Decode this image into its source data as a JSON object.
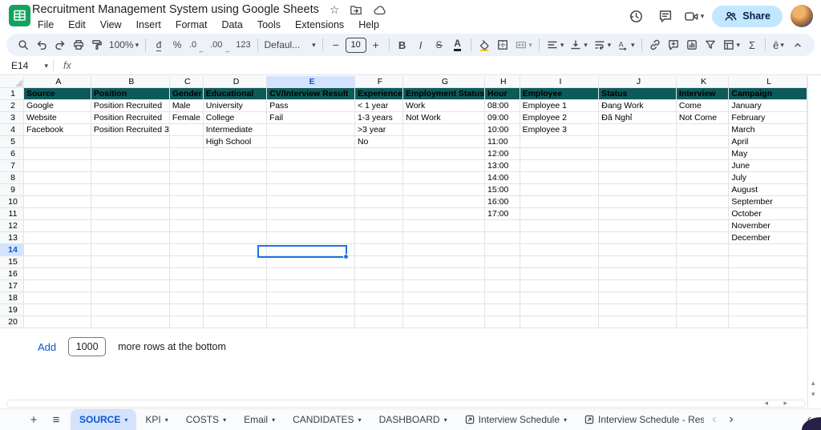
{
  "titlebar": {
    "title": "Recruitment Management System using Google Sheets",
    "menus": [
      "File",
      "Edit",
      "View",
      "Insert",
      "Format",
      "Data",
      "Tools",
      "Extensions",
      "Help"
    ],
    "share_label": "Share"
  },
  "toolbar": {
    "zoom_value": "100%",
    "currency_symbol": "đ",
    "percent_symbol": "%",
    "decrease_decimal": ".0",
    "increase_decimal": ".00",
    "more_formats": "123",
    "font_name": "Defaul...",
    "font_size": "10",
    "bold": "B",
    "italic": "I",
    "strikethrough": "S",
    "text_color": "A",
    "minus": "−",
    "plus": "+",
    "sum_symbol": "Σ",
    "input_tools": "ê"
  },
  "formula_bar": {
    "cell_reference": "E14",
    "fx_label": "fx",
    "content": ""
  },
  "grid": {
    "column_letters": [
      "A",
      "B",
      "C",
      "D",
      "E",
      "F",
      "G",
      "H",
      "I",
      "J",
      "K",
      "L"
    ],
    "selected_column": "E",
    "selected_row": 14,
    "selected_cell": "E14",
    "header_row": [
      "Source",
      "Position",
      "Gender",
      "Educational",
      "CV/Interview Result",
      "Experience",
      "Employment Status",
      "Hour",
      "Employee",
      "Status",
      "Interview",
      "Campaign"
    ],
    "data_rows": [
      [
        "Google",
        "Position Recruited",
        "Male",
        "University",
        "Pass",
        "< 1 year",
        "Work",
        "08:00",
        "Employee 1",
        "Đang Work",
        "Come",
        "January"
      ],
      [
        "Website",
        "Position Recruited",
        "Female",
        "College",
        "Fail",
        "1-3 years",
        "Not Work",
        "09:00",
        "Employee 2",
        "Đã Nghỉ",
        "Not Come",
        "February"
      ],
      [
        "Facebook",
        "Position Recruited 3",
        "",
        "Intermediate",
        "",
        ">3 year",
        "",
        "10:00",
        "Employee 3",
        "",
        "",
        "March"
      ],
      [
        "",
        "",
        "",
        "High School",
        "",
        "No",
        "",
        "11:00",
        "",
        "",
        "",
        "April"
      ],
      [
        "",
        "",
        "",
        "",
        "",
        "",
        "",
        "12:00",
        "",
        "",
        "",
        "May"
      ],
      [
        "",
        "",
        "",
        "",
        "",
        "",
        "",
        "13:00",
        "",
        "",
        "",
        "June"
      ],
      [
        "",
        "",
        "",
        "",
        "",
        "",
        "",
        "14:00",
        "",
        "",
        "",
        "July"
      ],
      [
        "",
        "",
        "",
        "",
        "",
        "",
        "",
        "15:00",
        "",
        "",
        "",
        "August"
      ],
      [
        "",
        "",
        "",
        "",
        "",
        "",
        "",
        "16:00",
        "",
        "",
        "",
        "September"
      ],
      [
        "",
        "",
        "",
        "",
        "",
        "",
        "",
        "17:00",
        "",
        "",
        "",
        "October"
      ],
      [
        "",
        "",
        "",
        "",
        "",
        "",
        "",
        "",
        "",
        "",
        "",
        "November"
      ],
      [
        "",
        "",
        "",
        "",
        "",
        "",
        "",
        "",
        "",
        "",
        "",
        "December"
      ],
      [
        "",
        "",
        "",
        "",
        "",
        "",
        "",
        "",
        "",
        "",
        "",
        ""
      ],
      [
        "",
        "",
        "",
        "",
        "",
        "",
        "",
        "",
        "",
        "",
        "",
        ""
      ],
      [
        "",
        "",
        "",
        "",
        "",
        "",
        "",
        "",
        "",
        "",
        "",
        ""
      ],
      [
        "",
        "",
        "",
        "",
        "",
        "",
        "",
        "",
        "",
        "",
        "",
        ""
      ],
      [
        "",
        "",
        "",
        "",
        "",
        "",
        "",
        "",
        "",
        "",
        "",
        ""
      ],
      [
        "",
        "",
        "",
        "",
        "",
        "",
        "",
        "",
        "",
        "",
        "",
        ""
      ],
      [
        "",
        "",
        "",
        "",
        "",
        "",
        "",
        "",
        "",
        "",
        "",
        ""
      ]
    ]
  },
  "add_rows": {
    "add_label": "Add",
    "row_count_value": "1000",
    "suffix_label": "more rows at the bottom"
  },
  "sheet_tabs": {
    "tabs": [
      {
        "label": "SOURCE",
        "active": true,
        "dropdown": true,
        "icon": false,
        "clipped": false
      },
      {
        "label": "KPI",
        "active": false,
        "dropdown": true,
        "icon": false,
        "clipped": false
      },
      {
        "label": "COSTS",
        "active": false,
        "dropdown": true,
        "icon": false,
        "clipped": false
      },
      {
        "label": "Email",
        "active": false,
        "dropdown": true,
        "icon": false,
        "clipped": false
      },
      {
        "label": "CANDIDATES",
        "active": false,
        "dropdown": true,
        "icon": false,
        "clipped": false
      },
      {
        "label": "DASHBOARD",
        "active": false,
        "dropdown": true,
        "icon": false,
        "clipped": false
      },
      {
        "label": "Interview Schedule",
        "active": false,
        "dropdown": true,
        "icon": true,
        "clipped": false
      },
      {
        "label": "Interview Schedule - Responsible",
        "active": false,
        "dropdown": false,
        "icon": true,
        "clipped": true
      }
    ]
  },
  "icons": {
    "dropdown_caret": "▾",
    "star": "☆",
    "nav_prev": "‹",
    "nav_next": "›",
    "collapse_right": "‹",
    "add_sheet": "+",
    "all_sheets": "≡",
    "scroll_up": "▴",
    "scroll_down": "▾",
    "scroll_left": "◂",
    "scroll_right": "▸",
    "dec_arrow": "←",
    "inc_arrow": "→"
  },
  "colors": {
    "accent_blue": "#0b57d0",
    "selection_blue": "#1a73e8",
    "header_teal": "#0e5a5a",
    "share_button_bg": "#c2e7ff",
    "toolbar_bg": "#edf2fa",
    "highlight_header_bg": "#d3e3fd",
    "sheets_green": "#12a35c"
  }
}
